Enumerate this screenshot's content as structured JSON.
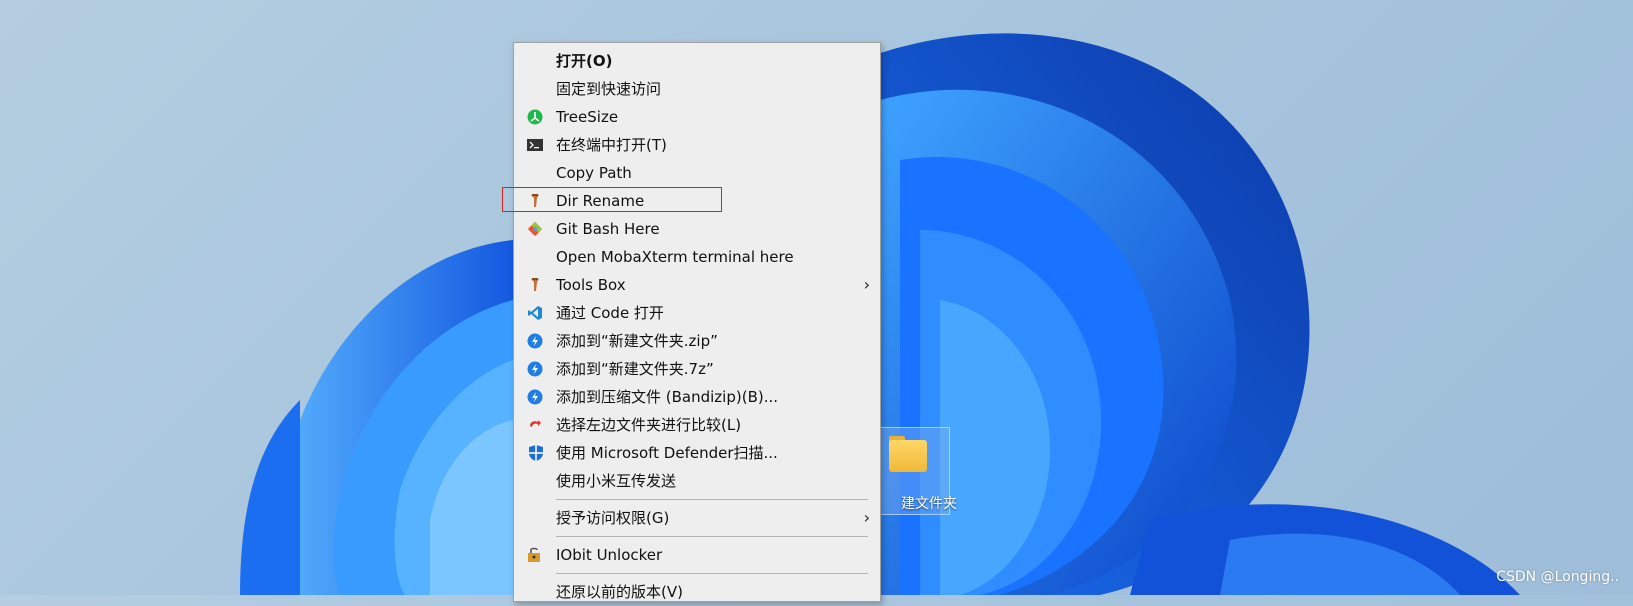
{
  "menu": {
    "items": [
      {
        "label": "打开(O)",
        "icon": "none"
      },
      {
        "label": "固定到快速访问",
        "icon": "none"
      },
      {
        "label": "TreeSize",
        "icon": "treesize-icon"
      },
      {
        "label": "在终端中打开(T)",
        "icon": "terminal-icon"
      },
      {
        "label": "Copy Path",
        "icon": "none"
      },
      {
        "label": "Dir Rename",
        "icon": "tools-icon"
      },
      {
        "label": "Git Bash Here",
        "icon": "git-icon"
      },
      {
        "label": "Open MobaXterm terminal here",
        "icon": "none"
      },
      {
        "label": "Tools Box",
        "icon": "tools-icon"
      },
      {
        "label": "通过 Code 打开",
        "icon": "vscode-icon"
      },
      {
        "label": "添加到“新建文件夹.zip”",
        "icon": "bandizip-icon"
      },
      {
        "label": "添加到“新建文件夹.7z”",
        "icon": "bandizip-icon"
      },
      {
        "label": "添加到压缩文件 (Bandizip)(B)...",
        "icon": "bandizip-icon"
      },
      {
        "label": "选择左边文件夹进行比较(L)",
        "icon": "compare-icon"
      },
      {
        "label": "使用 Microsoft Defender扫描...",
        "icon": "defender-icon"
      },
      {
        "label": "使用小米互传发送",
        "icon": "none"
      },
      {
        "label": "授予访问权限(G)",
        "icon": "none"
      },
      {
        "label": "IObit Unlocker",
        "icon": "unlocker-icon"
      },
      {
        "label": "还原以前的版本(V)",
        "icon": "none"
      }
    ]
  },
  "desktop": {
    "folder_label": "建文件夹"
  },
  "watermark": "CSDN @Longing..",
  "colors": {
    "menu_bg": "#eeeeee",
    "highlight": "#e02020",
    "wallpaper_blue": "#1565e8"
  }
}
